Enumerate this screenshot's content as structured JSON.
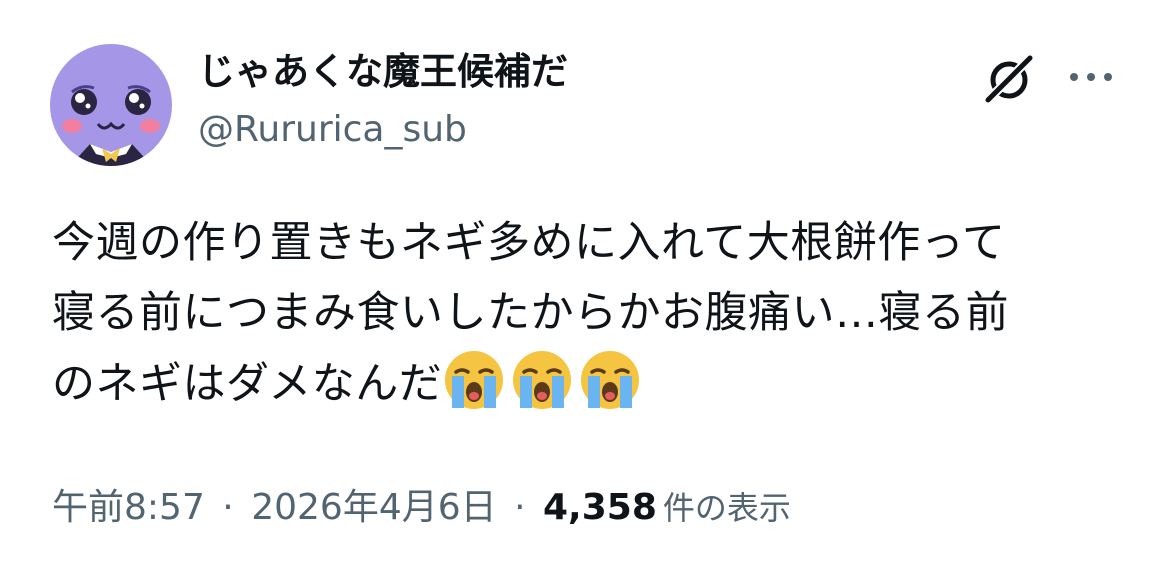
{
  "user": {
    "display_name": "じゃあくな魔王候補だ",
    "handle": "@Rururica_sub"
  },
  "tweet": {
    "lines": [
      "今週の作り置きもネギ多めに入れて大根餅作って",
      "寝る前につまみ食いしたからかお腹痛い…寝る前",
      "のネギはダメなんだ"
    ],
    "trailing_emoji": [
      "loudly-crying-face",
      "loudly-crying-face",
      "loudly-crying-face"
    ]
  },
  "meta": {
    "time": "午前8:57",
    "separator": "·",
    "date": "2026年4月6日",
    "views_count": "4,358",
    "views_label": "件の表示"
  },
  "colors": {
    "text_primary": "#0f1419",
    "text_secondary": "#536471",
    "avatar_background": "#a596e8"
  }
}
